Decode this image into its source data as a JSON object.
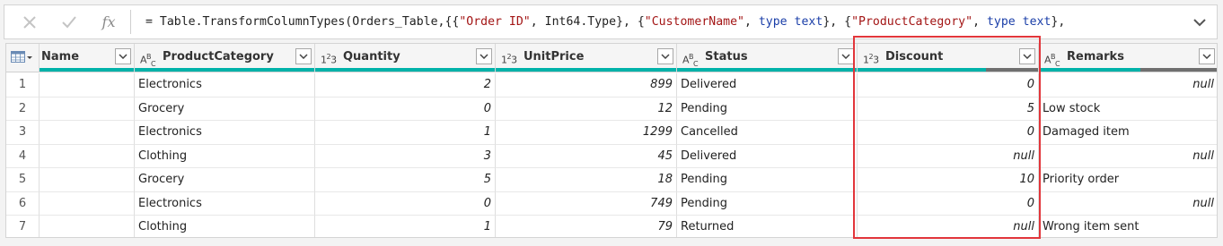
{
  "formula_bar": {
    "cancel_icon": "x-icon",
    "confirm_icon": "check-icon",
    "fx_label": "fx",
    "formula_parts": [
      {
        "t": "= Table.TransformColumnTypes(Orders_Table,{{",
        "c": ""
      },
      {
        "t": "\"Order ID\"",
        "c": "s"
      },
      {
        "t": ", Int64.Type}, {",
        "c": ""
      },
      {
        "t": "\"CustomerName\"",
        "c": "s"
      },
      {
        "t": ", ",
        "c": ""
      },
      {
        "t": "type text",
        "c": "k"
      },
      {
        "t": "}, {",
        "c": ""
      },
      {
        "t": "\"ProductCategory\"",
        "c": "s"
      },
      {
        "t": ", ",
        "c": ""
      },
      {
        "t": "type text",
        "c": "k"
      },
      {
        "t": "},",
        "c": ""
      }
    ],
    "expand_icon": "chevron-down-icon"
  },
  "grid": {
    "columns": [
      {
        "name": "Name",
        "type": "",
        "quality": 1.0,
        "error": 0
      },
      {
        "name": "ProductCategory",
        "type": "ABC",
        "quality": 1.0,
        "error": 0
      },
      {
        "name": "Quantity",
        "type": "123",
        "quality": 1.0,
        "error": 0
      },
      {
        "name": "UnitPrice",
        "type": "123",
        "quality": 1.0,
        "error": 0
      },
      {
        "name": "Status",
        "type": "ABC",
        "quality": 1.0,
        "error": 0
      },
      {
        "name": "Discount",
        "type": "123",
        "quality": 0.71,
        "error": 0.29
      },
      {
        "name": "Remarks",
        "type": "ABC",
        "quality": 0.57,
        "error": 0.43
      }
    ],
    "rows": [
      [
        "1",
        "",
        "Electronics",
        "2",
        "899",
        "Delivered",
        "0",
        "null"
      ],
      [
        "2",
        "",
        "Grocery",
        "0",
        "12",
        "Pending",
        "5",
        "Low stock"
      ],
      [
        "3",
        "",
        "Electronics",
        "1",
        "1299",
        "Cancelled",
        "0",
        "Damaged item"
      ],
      [
        "4",
        "",
        "Clothing",
        "3",
        "45",
        "Delivered",
        "null",
        "null"
      ],
      [
        "5",
        "",
        "Grocery",
        "5",
        "18",
        "Pending",
        "10",
        "Priority order"
      ],
      [
        "6",
        "",
        "Electronics",
        "0",
        "749",
        "Pending",
        "0",
        "null"
      ],
      [
        "7",
        "",
        "Clothing",
        "1",
        "79",
        "Returned",
        "null",
        "Wrong item sent"
      ]
    ]
  },
  "colors": {
    "quality_valid": "#00b2a9",
    "quality_empty": "#6f6f6f",
    "highlight": "#e2363b",
    "string_literal": "#a31515",
    "keyword": "#1a3ea8"
  }
}
